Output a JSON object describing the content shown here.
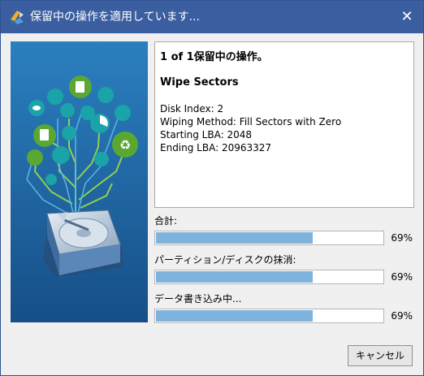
{
  "window": {
    "title": "保留中の操作を適用しています...",
    "close_glyph": "✕"
  },
  "info": {
    "heading": "1 of 1保留中の操作。",
    "operation": "Wipe Sectors",
    "details": [
      "Disk Index: 2",
      "Wiping Method: Fill Sectors with Zero",
      "Starting LBA: 2048",
      "Ending LBA: 20963327"
    ]
  },
  "progress": [
    {
      "label": "合計:",
      "percent": 69,
      "percent_text": "69%"
    },
    {
      "label": "パーティション/ディスクの抹消:",
      "percent": 69,
      "percent_text": "69%"
    },
    {
      "label": "データ書き込み中...",
      "percent": 69,
      "percent_text": "69%"
    }
  ],
  "buttons": {
    "cancel": "キャンセル"
  },
  "colors": {
    "titlebar": "#3b5ea0",
    "art_background": "#1f6aa5",
    "progress_fill": "#7eb3de",
    "green_node": "#5aa832",
    "teal_node": "#1aa3a8"
  },
  "icons": {
    "app": "partition-wizard-icon",
    "close": "close-icon",
    "illustration": "hard-drive-data-tree-illustration"
  }
}
